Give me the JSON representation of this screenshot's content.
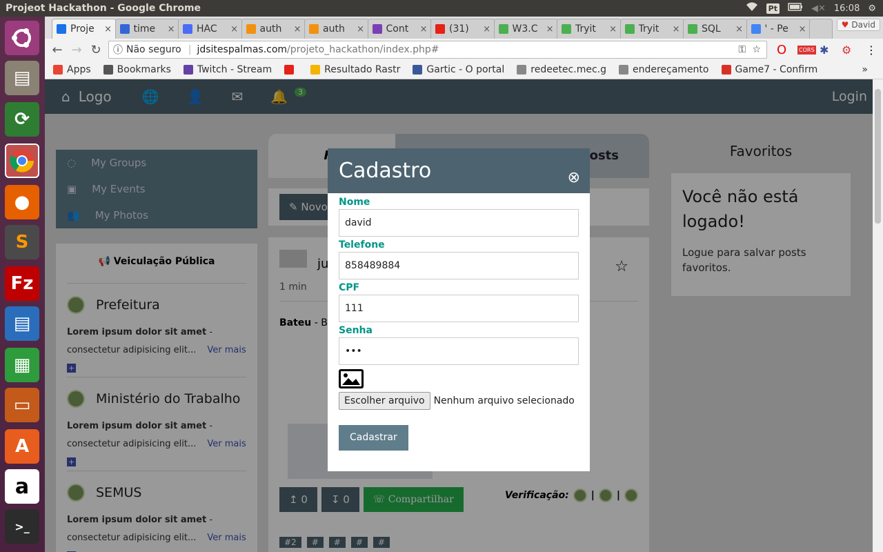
{
  "os": {
    "window_title": "Projeot Hackathon - Google Chrome",
    "lang_indicator": "Pt",
    "clock": "16:08"
  },
  "browser": {
    "profile_name": "David",
    "tabs": [
      {
        "label": "Proje",
        "color": "#1a73e8"
      },
      {
        "label": "time",
        "color": "#3367d6"
      },
      {
        "label": "HAC",
        "color": "#4a6cf7"
      },
      {
        "label": "auth",
        "color": "#f29111"
      },
      {
        "label": "auth",
        "color": "#f29111"
      },
      {
        "label": "Cont",
        "color": "#7b3fb5"
      },
      {
        "label": "(31)",
        "color": "#e62117"
      },
      {
        "label": "W3.C",
        "color": "#4caf50"
      },
      {
        "label": "Tryit",
        "color": "#4caf50"
      },
      {
        "label": "Tryit",
        "color": "#4caf50"
      },
      {
        "label": "SQL",
        "color": "#4caf50"
      },
      {
        "label": "' - Pe",
        "color": "#4285f4"
      }
    ],
    "security_label": "Não seguro",
    "url_host": "jdsitespalmas.com",
    "url_path": "/projeto_hackathon/index.php#",
    "bookmarks": [
      {
        "label": "Apps",
        "color": "#ea4335"
      },
      {
        "label": "Bookmarks",
        "color": "#555555"
      },
      {
        "label": "Twitch - Stream",
        "color": "#6441a5"
      },
      {
        "label": "",
        "color": "#e62117"
      },
      {
        "label": "Resultado Rastr",
        "color": "#f4b400"
      },
      {
        "label": "Gartic - O portal",
        "color": "#3b5998"
      },
      {
        "label": "redeetec.mec.g",
        "color": "#888888"
      },
      {
        "label": "endereçamento",
        "color": "#888888"
      },
      {
        "label": "Game7 - Confirm",
        "color": "#d93025"
      }
    ]
  },
  "site": {
    "nav": {
      "logo": "Logo",
      "notif_count": "3",
      "login": "Login"
    },
    "left_menu": [
      {
        "label": "My Groups",
        "icon": "circle-notch-icon"
      },
      {
        "label": "My Events",
        "icon": "calendar-check-icon"
      },
      {
        "label": "My Photos",
        "icon": "users-icon"
      }
    ],
    "veiculacao": {
      "title": "Veiculação Pública",
      "items": [
        {
          "name": "Prefeitura",
          "bold": "Lorem ipsum dolor sit amet",
          "rest": " - consectetur adipisicing elit...",
          "link": "Ver mais"
        },
        {
          "name": "Ministério do Trabalho",
          "bold": "Lorem ipsum dolor sit amet",
          "rest": " - consectetur adipisicing elit...",
          "link": "Ver mais"
        },
        {
          "name": "SEMUS",
          "bold": "Lorem ipsum dolor sit amet",
          "rest": " - consectetur adipisicing elit...",
          "link": "Ver mais"
        }
      ]
    },
    "center": {
      "tab_feed": "Fe",
      "tab_posts": "Posts",
      "new_button": "Novo",
      "post": {
        "user": "ju",
        "time": "1 min",
        "body_bold": "Bateu",
        "body_rest": " - Ba",
        "up_count": "0",
        "down_count": "0",
        "share": "Compartilhar",
        "verification": "Verificação:",
        "tags": [
          "#2",
          "#",
          "#",
          "#",
          "#"
        ]
      }
    },
    "favoritos": {
      "title": "Favoritos",
      "heading": "Você não está logado!",
      "text": "Logue para salvar posts favoritos."
    }
  },
  "modal": {
    "title": "Cadastro",
    "fields": {
      "nome_label": "Nome",
      "nome_value": "david",
      "telefone_label": "Telefone",
      "telefone_value": "858489884",
      "cpf_label": "CPF",
      "cpf_value": "111",
      "senha_label": "Senha",
      "senha_value": "•••"
    },
    "file_button": "Escolher arquivo",
    "file_status": "Nenhum arquivo selecionado",
    "submit": "Cadastrar"
  }
}
